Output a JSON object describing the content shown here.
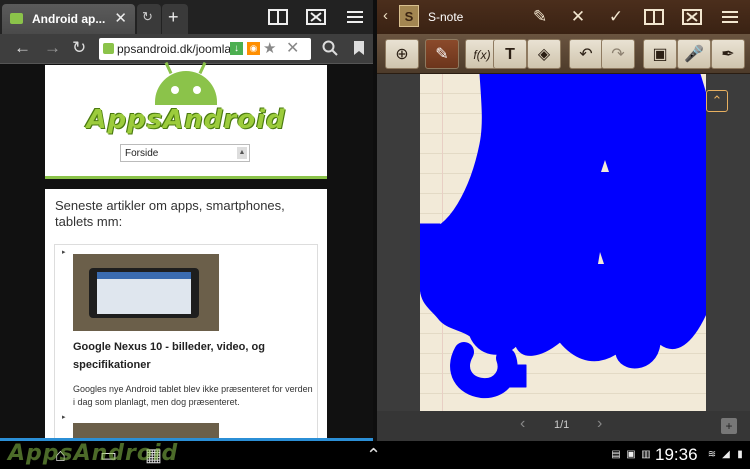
{
  "browser": {
    "tabs": [
      {
        "title": "Android ap...",
        "close": "✕"
      },
      {
        "title": "",
        "icon": "refresh-icon"
      },
      {
        "title": "",
        "icon": "plus-icon"
      }
    ],
    "url": "ppsandroid.dk/joomla/",
    "page": {
      "site_logo": "AppsAndroid",
      "menu_select": "Forside",
      "section_heading": "Seneste artikler om apps, smartphones, tablets mm:",
      "articles": [
        {
          "title": "Google Nexus 10 - billeder, video, og specifikationer",
          "excerpt": "Googles nye Android tablet blev ikke præsenteret for verden i dag som planlagt, men dog præsenteret."
        }
      ]
    }
  },
  "snote": {
    "app_name": "S-note",
    "page_counter": "1/1",
    "pen_color": "#0000ff",
    "paper_color": "#f2ead8"
  },
  "system": {
    "clock": "19:36",
    "watermark": "AppsAndroid"
  },
  "icons": [
    "back-icon",
    "forward-icon",
    "refresh-icon",
    "search-icon",
    "bookmark-icon",
    "tabs-icon",
    "close-icon",
    "menu-icon",
    "pen-icon",
    "undo-icon",
    "redo-icon",
    "eraser-icon",
    "formula-icon",
    "text-icon",
    "image-icon",
    "mic-icon",
    "save-icon"
  ]
}
